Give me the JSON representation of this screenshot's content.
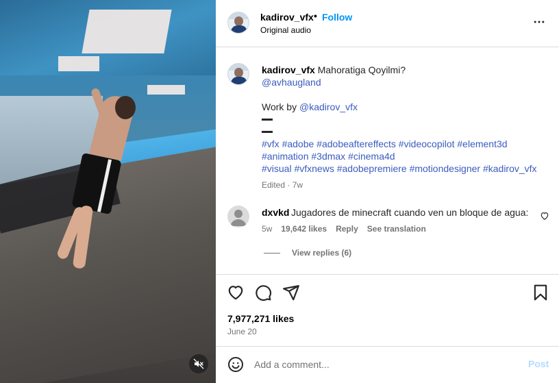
{
  "media": {
    "mute_icon": "speaker-muted-icon"
  },
  "header": {
    "username": "kadirov_vfx",
    "separator": "•",
    "follow_label": "Follow",
    "audio": "Original audio",
    "more_icon": "more-horizontal-icon"
  },
  "caption": {
    "username": "kadirov_vfx",
    "text": "Mahoratiga Qoyilmi?",
    "mention": "@avhaugland",
    "work_by": "Work by",
    "work_by_mention": "@kadirov_vfx",
    "hashtags_line1": "#vfx #adobe #adobeaftereffects #videocopilot #element3d",
    "hashtags_line2": "#animation #3dmax #cinema4d",
    "hashtags_line3": "#visual #vfxnews #adobepremiere #motiondesigner #kadirov_vfx",
    "edited": "Edited · 7w"
  },
  "comment": {
    "username": "dxvkd",
    "text": "Jugadores de minecraft cuando ven un bloque de agua:",
    "age": "5w",
    "likes": "19,642 likes",
    "reply": "Reply",
    "translate": "See translation",
    "view_replies": "View replies (6)"
  },
  "actions": {
    "icons": [
      "heart-icon",
      "comment-icon",
      "share-icon",
      "bookmark-icon"
    ]
  },
  "stats": {
    "likes": "7,977,271 likes",
    "date": "June 20"
  },
  "comment_box": {
    "placeholder": "Add a comment...",
    "post_label": "Post"
  },
  "colors": {
    "accent": "#0095f6",
    "link": "#3b5bbf",
    "muted": "#737373",
    "post_disabled": "#b3dbff"
  }
}
